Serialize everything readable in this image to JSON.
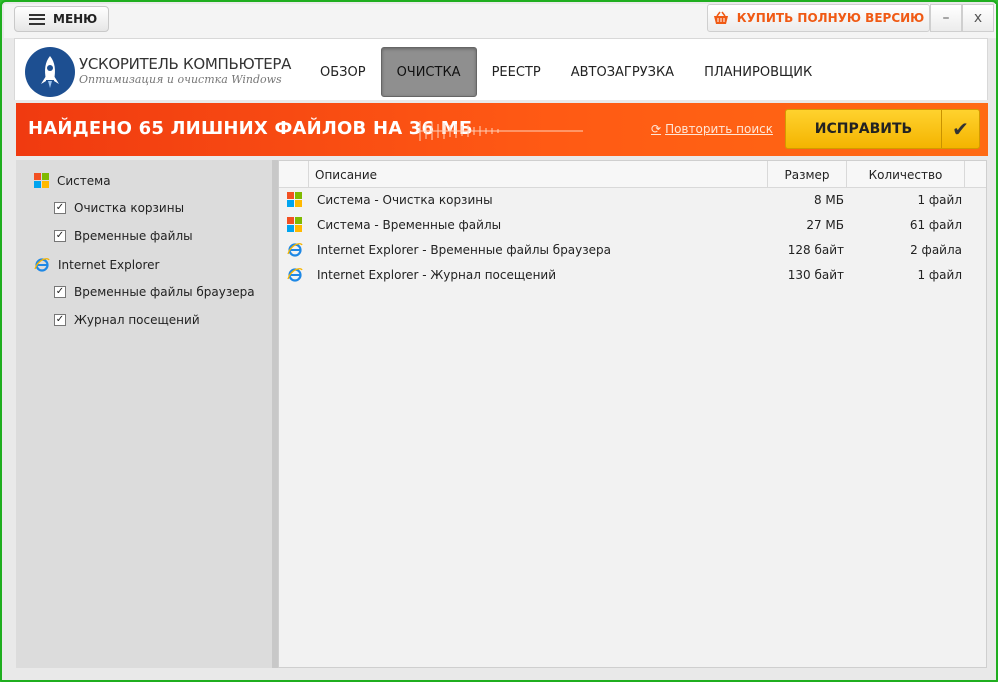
{
  "topbar": {
    "menu_label": "МЕНЮ",
    "buy_label": "КУПИТЬ ПОЛНУЮ ВЕРСИЮ",
    "minimize": "–",
    "close": "x"
  },
  "brand": {
    "title": "УСКОРИТЕЛЬ КОМПЬЮТЕРА",
    "subtitle": "Оптимизация и очистка Windows"
  },
  "nav": {
    "items": [
      {
        "label": "ОБЗОР"
      },
      {
        "label": "ОЧИСТКА"
      },
      {
        "label": "РЕЕСТР"
      },
      {
        "label": "АВТОЗАГРУЗКА"
      },
      {
        "label": "ПЛАНИРОВЩИК"
      }
    ],
    "active": "ОЧИСТКА"
  },
  "banner": {
    "message": "НАЙДЕНО 65 ЛИШНИХ ФАЙЛОВ НА 36 МБ",
    "retry_label": "Повторить поиск",
    "fix_label": "ИСПРАВИТЬ"
  },
  "tree": {
    "groups": [
      {
        "label": "Система",
        "icon": "windows-icon",
        "children": [
          {
            "label": "Очистка корзины",
            "checked": true
          },
          {
            "label": "Временные файлы",
            "checked": true
          }
        ]
      },
      {
        "label": "Internet Explorer",
        "icon": "ie-icon",
        "children": [
          {
            "label": "Временные файлы браузера",
            "checked": true
          },
          {
            "label": "Журнал посещений",
            "checked": true
          }
        ]
      }
    ]
  },
  "table": {
    "headers": {
      "description": "Описание",
      "size": "Размер",
      "count": "Количество"
    },
    "rows": [
      {
        "icon": "windows-icon",
        "description": "Система - Очистка корзины",
        "size": "8 МБ",
        "count": "1 файл"
      },
      {
        "icon": "windows-icon",
        "description": "Система - Временные файлы",
        "size": "27 МБ",
        "count": "61 файл"
      },
      {
        "icon": "ie-icon",
        "description": "Internet Explorer - Временные файлы браузера",
        "size": "128 байт",
        "count": "2 файла"
      },
      {
        "icon": "ie-icon",
        "description": "Internet Explorer - Журнал посещений",
        "size": "130 байт",
        "count": "1 файл"
      }
    ]
  },
  "colors": {
    "accent": "#ff5a14",
    "fix_button": "#f4b400",
    "window_border": "#1fae1f"
  }
}
